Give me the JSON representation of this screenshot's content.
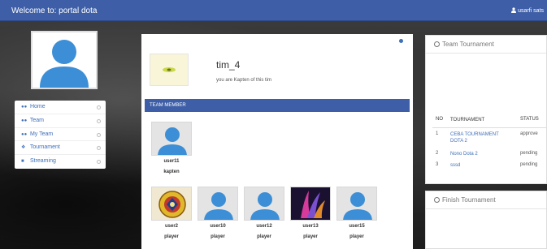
{
  "topbar": {
    "title": "Welcome to: portal dota",
    "user": "usarfi sats"
  },
  "sidebar": {
    "items": [
      {
        "label": "Home",
        "icon": "users-icon"
      },
      {
        "label": "Team",
        "icon": "users-icon"
      },
      {
        "label": "My Team",
        "icon": "users-icon"
      },
      {
        "label": "Tournament",
        "icon": "info-icon"
      },
      {
        "label": "Streaming",
        "icon": "camera-icon"
      }
    ]
  },
  "team": {
    "name": "tim_4",
    "subtitle": "you are Kapten of this tim",
    "section_title": "TEAM MEMBER",
    "captain": {
      "name": "user11",
      "role": "kapten"
    },
    "members": [
      {
        "name": "user2",
        "role": "player",
        "avatar": "emblem"
      },
      {
        "name": "user10",
        "role": "player",
        "avatar": "default"
      },
      {
        "name": "user12",
        "role": "player",
        "avatar": "default"
      },
      {
        "name": "user13",
        "role": "player",
        "avatar": "abstract"
      },
      {
        "name": "user15",
        "role": "player",
        "avatar": "default"
      }
    ]
  },
  "team_tournament": {
    "title": "Team Tournament",
    "columns": [
      "NO",
      "TOURNAMENT",
      "STATUS"
    ],
    "rows": [
      {
        "no": "1",
        "tournament": "CEBA TOURNAMENT DOTA 2",
        "status": "approve"
      },
      {
        "no": "2",
        "tournament": "Nono Dota 2",
        "status": "pending"
      },
      {
        "no": "3",
        "tournament": "sssd",
        "status": "pending"
      }
    ]
  },
  "finish_tournament": {
    "title": "Finish Tournament"
  },
  "colors": {
    "primary": "#3e5fa7",
    "link": "#3e6fb9",
    "avatar_blue": "#3c8fd6"
  }
}
